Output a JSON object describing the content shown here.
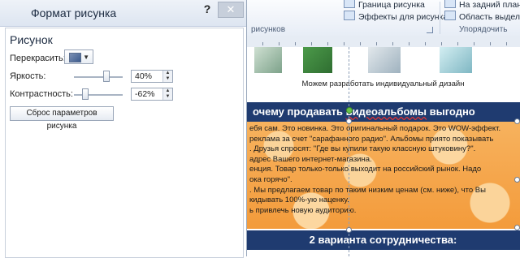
{
  "dialog": {
    "title": "Формат рисунка",
    "help": "?",
    "section_title": "Рисунок",
    "recolor_label": "Перекрасить:",
    "brightness_label": "Яркость:",
    "brightness_value": "40%",
    "brightness_level": 0.7,
    "contrast_label": "Контрастность:",
    "contrast_value": "-62%",
    "contrast_level": 0.19,
    "reset_button": "Сброс параметров рисунка"
  },
  "ribbon": {
    "border_item": "Граница рисунка",
    "effects_item": "Эффекты для рисунка",
    "bring_forward_item": "На задний план",
    "selection_pane_item": "Область выделения",
    "group_label_styles": "рисунков",
    "group_label_arrange": "Упорядочить"
  },
  "document": {
    "caption": "Можем разработать индивидуальный дизайн",
    "banner_pre": "очему продавать ",
    "banner_hl": "видеоальбомы",
    "banner_post": " выгодно",
    "lines": [
      "ебя сам. Это новинка. Это оригинальный подарок. Это WOW-эффект.",
      "реклама за счет \"сарафанного радио\". Альбомы приято показывать",
      ". Друзья спросят: \"Где вы купили такую классную штуковину?\".",
      "адрес Вашего интернет-магазина.",
      "енция. Товар только-только выходит на российский рынок. Надо",
      "ока горячо\".",
      ". Мы предлагаем товар по таким низким ценам (см. ниже), что Вы",
      "кидывать 100%-ую наценку.",
      "ь привлечь новую аудиторию."
    ],
    "banner2": "2 варианта сотрудничества:"
  }
}
